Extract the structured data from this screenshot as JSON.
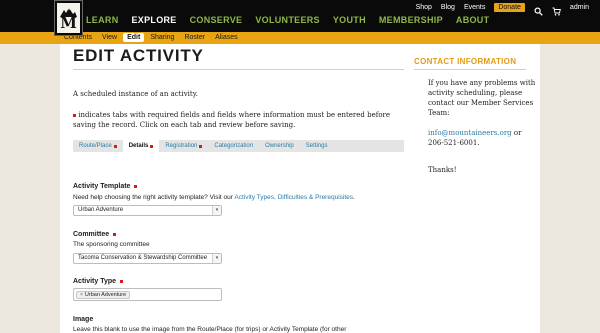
{
  "logo": {
    "letter": "M"
  },
  "utility": {
    "shop": "Shop",
    "blog": "Blog",
    "events": "Events",
    "donate": "Donate",
    "user": "admin"
  },
  "mainnav": {
    "items": [
      "LEARN",
      "EXPLORE",
      "CONSERVE",
      "VOLUNTEERS",
      "YOUTH",
      "MEMBERSHIP",
      "ABOUT"
    ],
    "active": "EXPLORE"
  },
  "subtabs": [
    "Contents",
    "View",
    "Edit",
    "Sharing",
    "Roster",
    "Aliases"
  ],
  "page": {
    "title": "EDIT ACTIVITY",
    "intro": "A scheduled instance of an activity.",
    "hint": "indicates tabs with required fields and fields where information must be entered before saving the record. Click on each tab and review before saving."
  },
  "tabs": [
    {
      "label": "Route/Place",
      "required": true
    },
    {
      "label": "Details",
      "required": true
    },
    {
      "label": "Registration",
      "required": true
    },
    {
      "label": "Categorization",
      "required": false
    },
    {
      "label": "Ownership",
      "required": false
    },
    {
      "label": "Settings",
      "required": false
    }
  ],
  "form": {
    "template": {
      "label": "Activity Template",
      "help_prefix": "Need help choosing the right activity template? Visit our ",
      "help_link": "Activity Types, Difficulties & Prerequisites",
      "help_suffix": ".",
      "value": "Urban Adventure"
    },
    "committee": {
      "label": "Committee",
      "help": "The sponsoring committee",
      "value": "Tacoma Conservation & Stewardship Committee"
    },
    "type": {
      "label": "Activity Type",
      "token": "Urban Adventure"
    },
    "image": {
      "label": "Image",
      "help": "Leave this blank to use the image from the Route/Place (for trips) or Activity Template (for other"
    }
  },
  "sidebar": {
    "title": "CONTACT INFORMATION",
    "text": "If you have any problems with activity scheduling, please contact our Member Services Team:",
    "email": "info@mountaineers.org",
    "email_suffix": " or",
    "phone": "206-521-6001.",
    "thanks": "Thanks!"
  },
  "colors": {
    "nav_green": "#8fb84a",
    "accent_orange": "#e8a413",
    "link_blue": "#2a7ca8",
    "required_red": "#d11d1d"
  }
}
